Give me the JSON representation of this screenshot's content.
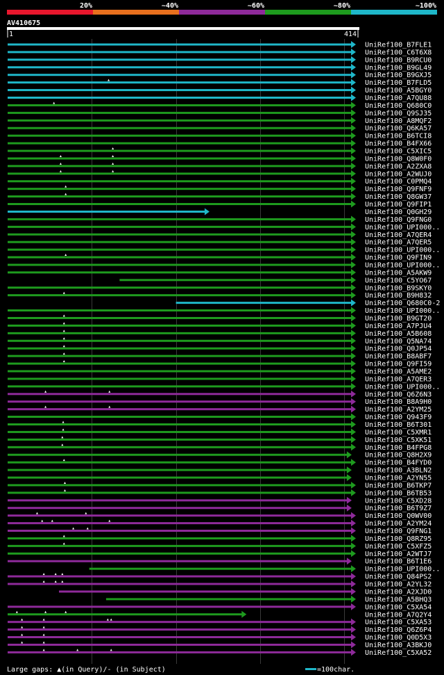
{
  "legend": {
    "bands": [
      {
        "label": "20%",
        "color": "#e8172d"
      },
      {
        "label": "~40%",
        "color": "#e8701e"
      },
      {
        "label": "~60%",
        "color": "#8e2a9a"
      },
      {
        "label": "~80%",
        "color": "#1e9b1e"
      },
      {
        "label": "~100%",
        "color": "#1fb7c9"
      }
    ]
  },
  "query": {
    "name": "AV410675",
    "start_label": "1",
    "end_label": "414",
    "length": 414
  },
  "footer": {
    "gaps_text": "Large gaps: ▲(in Query)/- (in Subject)",
    "scale_text": "=100char."
  },
  "colors": {
    "cyan": "#1fb7c9",
    "green": "#1e9b1e",
    "magenta": "#8e2a9a",
    "grid": "#3a3a3a"
  },
  "hits": [
    {
      "name": "UniRef100_B7FLE1",
      "c": "cyan",
      "s": 1,
      "e": 414,
      "gq": []
    },
    {
      "name": "UniRef100_C6T6X8",
      "c": "cyan",
      "s": 1,
      "e": 414,
      "gq": []
    },
    {
      "name": "UniRef100_B9RCU0",
      "c": "cyan",
      "s": 1,
      "e": 414,
      "gq": []
    },
    {
      "name": "UniRef100_B9GL49",
      "c": "cyan",
      "s": 1,
      "e": 414,
      "gq": []
    },
    {
      "name": "UniRef100_B9GXJ5",
      "c": "cyan",
      "s": 1,
      "e": 414,
      "gq": []
    },
    {
      "name": "UniRef100_B7FLD5",
      "c": "cyan",
      "s": 1,
      "e": 414,
      "gq": [
        121
      ]
    },
    {
      "name": "UniRef100_A5BGY0",
      "c": "cyan",
      "s": 1,
      "e": 414,
      "gq": []
    },
    {
      "name": "UniRef100_A7QU88",
      "c": "cyan",
      "s": 1,
      "e": 414,
      "gq": []
    },
    {
      "name": "UniRef100_Q680C0",
      "c": "green",
      "s": 1,
      "e": 414,
      "gq": [
        56
      ]
    },
    {
      "name": "UniRef100_Q9SJ35",
      "c": "green",
      "s": 1,
      "e": 414,
      "gq": []
    },
    {
      "name": "UniRef100_A8MQF2",
      "c": "green",
      "s": 1,
      "e": 414,
      "gq": []
    },
    {
      "name": "UniRef100_Q6KA57",
      "c": "green",
      "s": 1,
      "e": 414,
      "gq": []
    },
    {
      "name": "UniRef100_B6TCI8",
      "c": "green",
      "s": 1,
      "e": 414,
      "gq": []
    },
    {
      "name": "UniRef100_B4FX66",
      "c": "green",
      "s": 1,
      "e": 414,
      "gq": []
    },
    {
      "name": "UniRef100_C5XIC5",
      "c": "green",
      "s": 1,
      "e": 414,
      "gq": [
        126
      ]
    },
    {
      "name": "UniRef100_Q8W0F0",
      "c": "green",
      "s": 1,
      "e": 414,
      "gq": [
        64,
        126
      ]
    },
    {
      "name": "UniRef100_A2ZXA8",
      "c": "green",
      "s": 1,
      "e": 414,
      "gq": [
        64,
        126
      ]
    },
    {
      "name": "UniRef100_A2WUJ0",
      "c": "green",
      "s": 1,
      "e": 414,
      "gq": [
        64,
        126
      ]
    },
    {
      "name": "UniRef100_C0PMQ4",
      "c": "green",
      "s": 1,
      "e": 414,
      "gq": []
    },
    {
      "name": "UniRef100_Q9FNF9",
      "c": "green",
      "s": 1,
      "e": 414,
      "gq": [
        70
      ]
    },
    {
      "name": "UniRef100_Q8GW37",
      "c": "green",
      "s": 1,
      "e": 414,
      "gq": [
        70
      ]
    },
    {
      "name": "UniRef100_Q9FIP1",
      "c": "green",
      "s": 1,
      "e": 414,
      "gq": []
    },
    {
      "name": "UniRef100_Q0GH29",
      "c": "cyan",
      "s": 1,
      "e": 240,
      "gq": []
    },
    {
      "name": "UniRef100_Q9FNG0",
      "c": "green",
      "s": 1,
      "e": 414,
      "gq": []
    },
    {
      "name": "UniRef100_UPI000..",
      "c": "green",
      "s": 1,
      "e": 414,
      "gq": []
    },
    {
      "name": "UniRef100_A7QER4",
      "c": "green",
      "s": 1,
      "e": 414,
      "gq": []
    },
    {
      "name": "UniRef100_A7QER5",
      "c": "green",
      "s": 1,
      "e": 414,
      "gq": []
    },
    {
      "name": "UniRef100_UPI000..",
      "c": "green",
      "s": 1,
      "e": 414,
      "gq": []
    },
    {
      "name": "UniRef100_Q9FIN9",
      "c": "green",
      "s": 1,
      "e": 414,
      "gq": [
        70
      ]
    },
    {
      "name": "UniRef100_UPI000..",
      "c": "green",
      "s": 1,
      "e": 414,
      "gq": []
    },
    {
      "name": "UniRef100_A5AKW9",
      "c": "green",
      "s": 1,
      "e": 414,
      "gq": []
    },
    {
      "name": "UniRef100_C5YO67",
      "c": "green",
      "s": 134,
      "e": 414,
      "gq": []
    },
    {
      "name": "UniRef100_B9SKY0",
      "c": "green",
      "s": 1,
      "e": 414,
      "gq": []
    },
    {
      "name": "UniRef100_B9H832",
      "c": "green",
      "s": 1,
      "e": 414,
      "gq": [
        68
      ]
    },
    {
      "name": "UniRef100_Q680C0-2",
      "c": "cyan",
      "s": 201,
      "e": 414,
      "gq": []
    },
    {
      "name": "UniRef100_UPI000..",
      "c": "green",
      "s": 1,
      "e": 414,
      "gq": []
    },
    {
      "name": "UniRef100_B9GT20",
      "c": "green",
      "s": 1,
      "e": 414,
      "gq": [
        68
      ]
    },
    {
      "name": "UniRef100_A7PJU4",
      "c": "green",
      "s": 1,
      "e": 414,
      "gq": [
        68
      ]
    },
    {
      "name": "UniRef100_A5B608",
      "c": "green",
      "s": 1,
      "e": 414,
      "gq": [
        68
      ]
    },
    {
      "name": "UniRef100_Q5NA74",
      "c": "green",
      "s": 1,
      "e": 414,
      "gq": [
        68
      ]
    },
    {
      "name": "UniRef100_Q0JP54",
      "c": "green",
      "s": 1,
      "e": 414,
      "gq": [
        68
      ]
    },
    {
      "name": "UniRef100_B8ABF7",
      "c": "green",
      "s": 1,
      "e": 414,
      "gq": [
        68
      ]
    },
    {
      "name": "UniRef100_Q9FI59",
      "c": "green",
      "s": 1,
      "e": 414,
      "gq": [
        68
      ]
    },
    {
      "name": "UniRef100_A5AME2",
      "c": "green",
      "s": 1,
      "e": 414,
      "gq": []
    },
    {
      "name": "UniRef100_A7QER3",
      "c": "green",
      "s": 1,
      "e": 414,
      "gq": []
    },
    {
      "name": "UniRef100_UPI000..",
      "c": "green",
      "s": 1,
      "e": 414,
      "gq": []
    },
    {
      "name": "UniRef100_Q6Z6N3",
      "c": "magenta",
      "s": 1,
      "e": 414,
      "gq": [
        46,
        122
      ]
    },
    {
      "name": "UniRef100_B8A9H0",
      "c": "magenta",
      "s": 1,
      "e": 414,
      "gq": []
    },
    {
      "name": "UniRef100_A2YM25",
      "c": "magenta",
      "s": 1,
      "e": 414,
      "gq": [
        46,
        122
      ]
    },
    {
      "name": "UniRef100_Q943F9",
      "c": "green",
      "s": 1,
      "e": 414,
      "gq": []
    },
    {
      "name": "UniRef100_B6T301",
      "c": "green",
      "s": 1,
      "e": 414,
      "gq": [
        67
      ]
    },
    {
      "name": "UniRef100_C5XMR1",
      "c": "green",
      "s": 1,
      "e": 414,
      "gq": [
        67
      ]
    },
    {
      "name": "UniRef100_C5XK51",
      "c": "green",
      "s": 1,
      "e": 414,
      "gq": [
        66
      ]
    },
    {
      "name": "UniRef100_B4FPG8",
      "c": "green",
      "s": 1,
      "e": 414,
      "gq": [
        66
      ]
    },
    {
      "name": "UniRef100_Q8H2X9",
      "c": "green",
      "s": 1,
      "e": 409,
      "gq": []
    },
    {
      "name": "UniRef100_B4FYD0",
      "c": "green",
      "s": 1,
      "e": 414,
      "gq": [
        68
      ]
    },
    {
      "name": "UniRef100_A3BLN2",
      "c": "green",
      "s": 1,
      "e": 409,
      "gq": []
    },
    {
      "name": "UniRef100_A2YN55",
      "c": "green",
      "s": 1,
      "e": 409,
      "gq": []
    },
    {
      "name": "UniRef100_B6TKP7",
      "c": "green",
      "s": 1,
      "e": 414,
      "gq": [
        69
      ]
    },
    {
      "name": "UniRef100_B6TB53",
      "c": "green",
      "s": 1,
      "e": 414,
      "gq": [
        69
      ]
    },
    {
      "name": "UniRef100_C5XD28",
      "c": "magenta",
      "s": 1,
      "e": 409,
      "gq": []
    },
    {
      "name": "UniRef100_B6T9Z7",
      "c": "magenta",
      "s": 1,
      "e": 409,
      "gq": []
    },
    {
      "name": "UniRef100_Q0WV00",
      "c": "magenta",
      "s": 1,
      "e": 414,
      "gq": [
        36,
        94
      ]
    },
    {
      "name": "UniRef100_A2YM24",
      "c": "magenta",
      "s": 1,
      "e": 414,
      "gq": [
        42,
        54,
        122
      ]
    },
    {
      "name": "UniRef100_Q9FNG1",
      "c": "magenta",
      "s": 1,
      "e": 414,
      "gq": [
        79,
        96
      ]
    },
    {
      "name": "UniRef100_Q8RZ95",
      "c": "green",
      "s": 1,
      "e": 414,
      "gq": [
        68
      ]
    },
    {
      "name": "UniRef100_C5XFZ5",
      "c": "green",
      "s": 1,
      "e": 414,
      "gq": [
        68
      ]
    },
    {
      "name": "UniRef100_A2WTJ7",
      "c": "green",
      "s": 1,
      "e": 414,
      "gq": []
    },
    {
      "name": "UniRef100_B6T1E6",
      "c": "magenta",
      "s": 1,
      "e": 409,
      "gq": []
    },
    {
      "name": "UniRef100_UPI000..",
      "c": "green",
      "s": 98,
      "e": 414,
      "gq": []
    },
    {
      "name": "UniRef100_Q84PS2",
      "c": "magenta",
      "s": 1,
      "e": 414,
      "gq": [
        44,
        58,
        66
      ]
    },
    {
      "name": "UniRef100_A2YL32",
      "c": "magenta",
      "s": 1,
      "e": 414,
      "gq": [
        44,
        58,
        66
      ]
    },
    {
      "name": "UniRef100_A2XJD0",
      "c": "magenta",
      "s": 62,
      "e": 414,
      "gq": []
    },
    {
      "name": "UniRef100_A5BHQ3",
      "c": "green",
      "s": 118,
      "e": 414,
      "gq": []
    },
    {
      "name": "UniRef100_C5XA54",
      "c": "magenta",
      "s": 1,
      "e": 414,
      "gq": []
    },
    {
      "name": "UniRef100_A7Q2Y4",
      "c": "green",
      "s": 1,
      "e": 284,
      "gq": [
        12,
        46,
        70
      ]
    },
    {
      "name": "UniRef100_C5XA53",
      "c": "magenta",
      "s": 1,
      "e": 414,
      "gq": [
        18,
        44,
        120,
        124
      ]
    },
    {
      "name": "UniRef100_Q6Z6P4",
      "c": "magenta",
      "s": 1,
      "e": 414,
      "gq": [
        18,
        44
      ]
    },
    {
      "name": "UniRef100_Q0D5X3",
      "c": "magenta",
      "s": 1,
      "e": 414,
      "gq": [
        18,
        44
      ]
    },
    {
      "name": "UniRef100_A3BKJ0",
      "c": "magenta",
      "s": 1,
      "e": 414,
      "gq": [
        18,
        44
      ]
    },
    {
      "name": "UniRef100_C5XA52",
      "c": "magenta",
      "s": 1,
      "e": 414,
      "gq": [
        44,
        84,
        124
      ]
    }
  ]
}
